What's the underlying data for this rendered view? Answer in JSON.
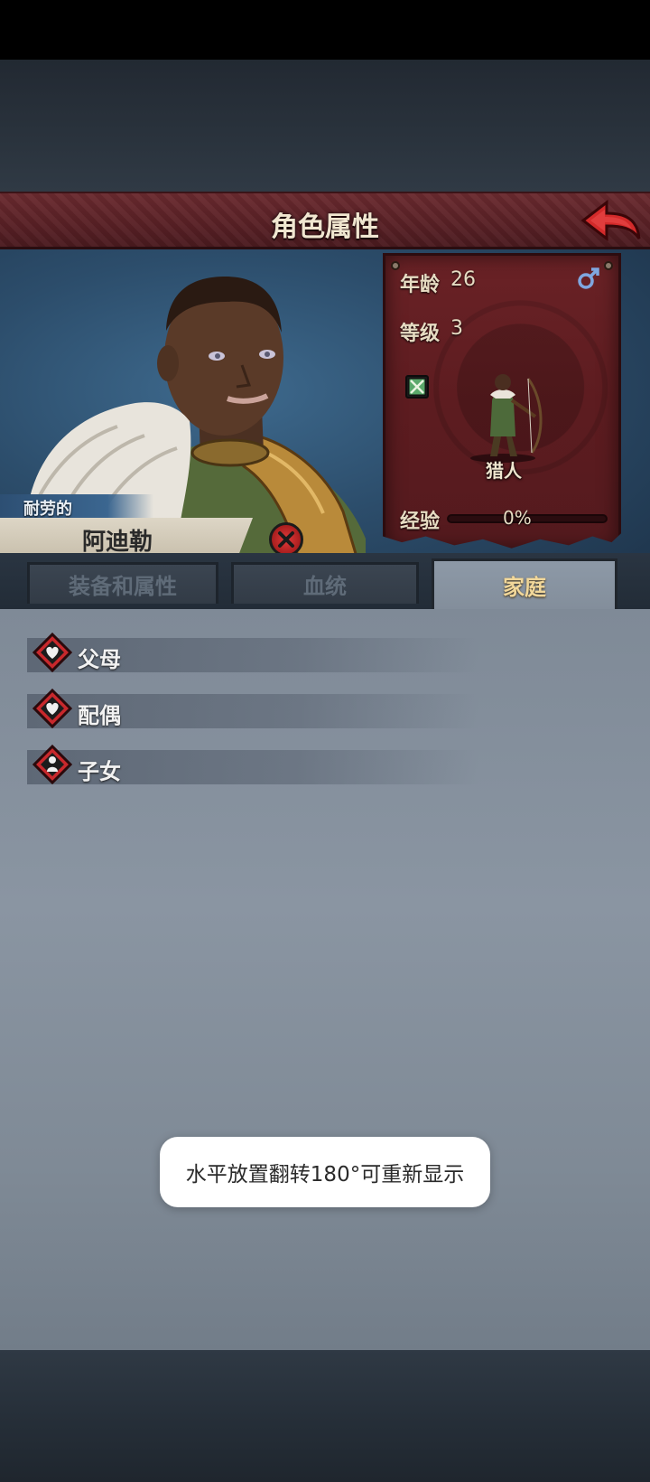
{
  "header": {
    "title": "角色属性"
  },
  "character": {
    "trait": "耐劳的",
    "name": "阿迪勒"
  },
  "stats": {
    "age_label": "年龄",
    "age_value": "26",
    "level_label": "等级",
    "level_value": "3",
    "class_name": "猎人",
    "exp_label": "经验",
    "exp_value": "0%",
    "exp_fraction": 0
  },
  "tabs": [
    {
      "label": "装备和属性",
      "active": false
    },
    {
      "label": "血统",
      "active": false
    },
    {
      "label": "家庭",
      "active": true
    }
  ],
  "family": [
    {
      "label": "父母",
      "icon": "heart-icon"
    },
    {
      "label": "配偶",
      "icon": "heart-icon"
    },
    {
      "label": "子女",
      "icon": "child-icon"
    }
  ],
  "toast": {
    "text": "水平放置翻转180°可重新显示"
  },
  "colors": {
    "title_bar": "#5a2126",
    "stats_card": "#5d1c20",
    "active_tab_text": "#f1d79a",
    "content_panel": "#8a95a2"
  }
}
